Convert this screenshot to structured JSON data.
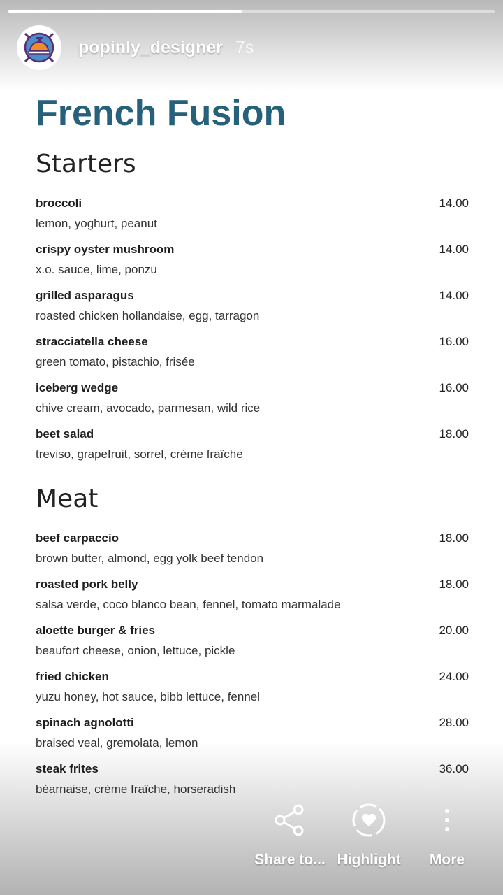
{
  "story": {
    "username": "popinly_designer",
    "time": "7s",
    "progress": 0.48,
    "avatar_icon": "service-bell-icon"
  },
  "menu": {
    "title": "French Fusion",
    "sections": [
      {
        "title": "Starters",
        "items": [
          {
            "name": "broccoli",
            "price": "14.00",
            "desc": "lemon, yoghurt, peanut"
          },
          {
            "name": "crispy oyster mushroom",
            "price": "14.00",
            "desc": "x.o. sauce, lime, ponzu"
          },
          {
            "name": "grilled asparagus",
            "price": "14.00",
            "desc": "roasted chicken hollandaise, egg, tarragon"
          },
          {
            "name": "stracciatella cheese",
            "price": "16.00",
            "desc": "green tomato, pistachio, frisée"
          },
          {
            "name": "iceberg wedge",
            "price": "16.00",
            "desc": "chive cream, avocado, parmesan, wild rice"
          },
          {
            "name": "beet salad",
            "price": "18.00",
            "desc": "treviso, grapefruit, sorrel, crème fraîche"
          }
        ]
      },
      {
        "title": "Meat",
        "items": [
          {
            "name": "beef carpaccio",
            "price": "18.00",
            "desc": "brown butter, almond, egg yolk beef tendon"
          },
          {
            "name": "roasted pork belly",
            "price": "18.00",
            "desc": "salsa verde, coco blanco bean, fennel, tomato marmalade"
          },
          {
            "name": "aloette burger & fries",
            "price": "20.00",
            "desc": "beaufort cheese, onion, lettuce, pickle"
          },
          {
            "name": "fried chicken",
            "price": "24.00",
            "desc": "yuzu honey, hot sauce, bibb lettuce, fennel"
          },
          {
            "name": "spinach agnolotti",
            "price": "28.00",
            "desc": "braised veal, gremolata, lemon"
          },
          {
            "name": "steak frites",
            "price": "36.00",
            "desc": "béarnaise, crème fraîche, horseradish"
          }
        ]
      }
    ]
  },
  "actions": {
    "share": {
      "label": "Share to...",
      "icon": "share-icon"
    },
    "highlight": {
      "label": "Highlight",
      "icon": "heart-icon"
    },
    "more": {
      "label": "More",
      "icon": "more-vertical-icon"
    }
  },
  "colors": {
    "title": "#26607a",
    "avatar_bg": "#4a8fc4",
    "avatar_ring": "#5b2a7a"
  }
}
